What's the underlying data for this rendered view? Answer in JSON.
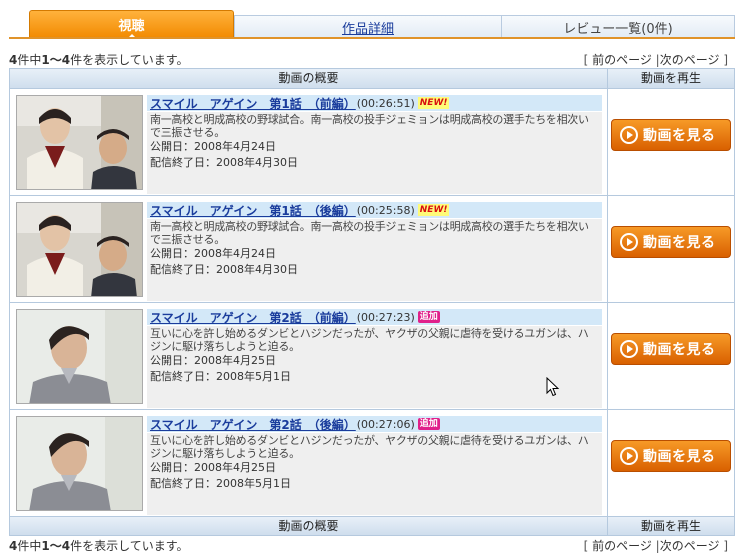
{
  "tabs": {
    "watch": "視聴",
    "details": "作品詳細",
    "reviews": "レビュー一覧(0件)"
  },
  "listing": {
    "count_bold_1": "4",
    "count_mid": "件中",
    "count_bold_2": "1〜4",
    "count_tail": "件を表示しています。",
    "pager_open": "[",
    "prev_page": "前のページ",
    "pager_sep": "|",
    "next_page": "次のページ",
    "pager_close": "]"
  },
  "table": {
    "col_summary": "動画の概要",
    "col_play": "動画を再生",
    "button_label": "動画を見る",
    "episodes": [
      {
        "title": "スマイル　アゲイン　第1話　（前編）",
        "duration": "(00:26:51)",
        "badge": "NEW!",
        "badge_type": "new",
        "description": "南一高校と明成高校の野球試合。南一高校の投手ジェミョンは明成高校の選手たちを相次いで三振させる。",
        "release": "公開日：2008年4月24日",
        "end": "配信終了日：2008年4月30日"
      },
      {
        "title": "スマイル　アゲイン　第1話　（後編）",
        "duration": "(00:25:58)",
        "badge": "NEW!",
        "badge_type": "new",
        "description": "南一高校と明成高校の野球試合。南一高校の投手ジェミョンは明成高校の選手たちを相次いで三振させる。",
        "release": "公開日：2008年4月24日",
        "end": "配信終了日：2008年4月30日"
      },
      {
        "title": "スマイル　アゲイン　第2話　（前編）",
        "duration": "(00:27:23)",
        "badge": "追加",
        "badge_type": "add",
        "description": "互いに心を許し始めるダンビとハジンだったが、ヤクザの父親に虐待を受けるユガンは、ハジンに駆け落ちしようと迫る。",
        "release": "公開日：2008年4月25日",
        "end": "配信終了日：2008年5月1日"
      },
      {
        "title": "スマイル　アゲイン　第2話　（後編）",
        "duration": "(00:27:06)",
        "badge": "追加",
        "badge_type": "add",
        "description": "互いに心を許し始めるダンビとハジンだったが、ヤクザの父親に虐待を受けるユガンは、ハジンに駆け落ちしようと迫る。",
        "release": "公開日：2008年4月25日",
        "end": "配信終了日：2008年5月1日"
      }
    ]
  },
  "colors": {
    "tab_orange": "#f28a00",
    "link_blue": "#1a3c9c",
    "button_orange": "#e06a00",
    "header_blue": "#cfdeed"
  },
  "icons": {
    "play": "play-circle-icon",
    "cursor": "mouse-pointer-icon"
  }
}
